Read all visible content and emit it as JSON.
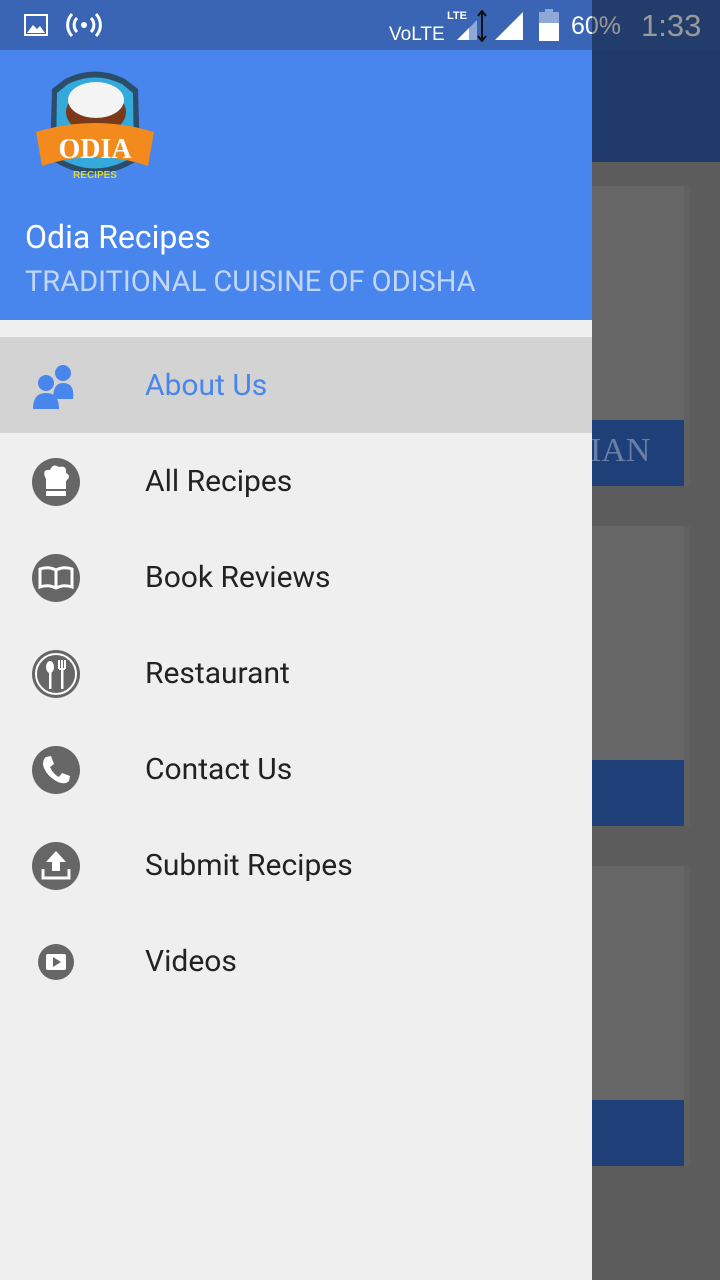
{
  "status_bar": {
    "volte": "VoLTE",
    "lte": "LTE",
    "battery": "60%",
    "time": "1:33",
    "icons": [
      "image-icon",
      "hotspot-icon",
      "signal-icon",
      "battery-icon"
    ]
  },
  "background": {
    "card_band_text": "IAN"
  },
  "drawer": {
    "header": {
      "logo_text": "ODIA",
      "logo_sub": "RECIPES",
      "title": "Odia Recipes",
      "subtitle": "TRADITIONAL CUISINE OF ODISHA",
      "color": "#4885ed"
    },
    "items": [
      {
        "label": "About Us",
        "icon": "users-icon",
        "active": true
      },
      {
        "label": "All Recipes",
        "icon": "chef-hat-icon"
      },
      {
        "label": "Book Reviews",
        "icon": "book-icon"
      },
      {
        "label": "Restaurant",
        "icon": "spoon-fork-icon"
      },
      {
        "label": "Contact Us",
        "icon": "phone-icon"
      },
      {
        "label": "Submit Recipes",
        "icon": "upload-icon"
      },
      {
        "label": "Videos",
        "icon": "play-icon"
      }
    ]
  }
}
